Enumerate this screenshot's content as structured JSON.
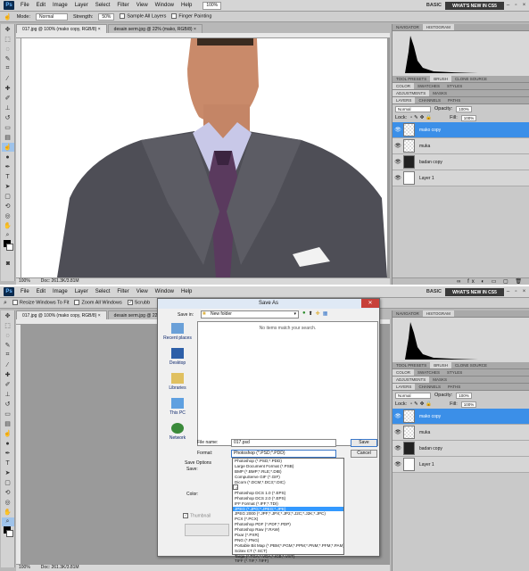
{
  "menubar": {
    "app_logo": "Ps",
    "items": [
      "File",
      "Edit",
      "Image",
      "Layer",
      "Select",
      "Filter",
      "View",
      "Window",
      "Help"
    ],
    "zoom": "100%",
    "workspace": "BASIC",
    "whats_new": "WHAT'S NEW IN CS5"
  },
  "top": {
    "options": {
      "mode_label": "Mode:",
      "mode_value": "Normal",
      "strength_label": "Strength:",
      "strength_value": "50%",
      "sample_all_layers": "Sample All Layers",
      "finger_painting": "Finger Painting"
    },
    "tabs": [
      "017.jpg @ 100% (mako copy, RGB/8) ×",
      "desain serm.jpg @ 22% (mako, RGB/8) ×"
    ],
    "status_zoom": "100%",
    "status_doc": "Doc: 261.3K/3.81M"
  },
  "bottom": {
    "options": {
      "resize_windows": "Resize Windows To Fit",
      "zoom_all_windows": "Zoom All Windows",
      "scrubby": "Scrubb"
    },
    "tabs": [
      "017.jpg @ 100% (mako copy, RGB/8) ×",
      "desain serm.jpg @ 22% (mako, RGB/8) ×"
    ],
    "status_zoom": "100%",
    "status_doc": "Doc: 261.3K/3.81M"
  },
  "panels": {
    "top_tabs": [
      "NAVIGATOR",
      "HISTOGRAM"
    ],
    "mid_tabs": [
      "TOOL PRESETS",
      "BRUSH",
      "CLONE SOURCE"
    ],
    "color_tabs": [
      "COLOR",
      "SWATCHES",
      "STYLES"
    ],
    "adjust_tabs": [
      "ADJUSTMENTS",
      "MASKS"
    ],
    "layer_tabs": [
      "LAYERS",
      "CHANNELS",
      "PATHS"
    ],
    "blend_mode": "Normal",
    "opacity_label": "Opacity:",
    "opacity_value": "100%",
    "lock_label": "Lock:",
    "fill_label": "Fill:",
    "fill_value": "100%",
    "layers": [
      "mako copy",
      "muka",
      "badan copy",
      "Layer 1"
    ]
  },
  "dialog": {
    "title": "Save As",
    "save_in_label": "Save in:",
    "save_in_value": "New folder",
    "empty_message": "No items match your search.",
    "places": [
      "Recent places",
      "Desktop",
      "Libraries",
      "This PC",
      "Network"
    ],
    "file_name_label": "File name:",
    "file_name_value": "017.psd",
    "format_label": "Format:",
    "format_value": "Photoshop (*.PSD;*.PDD)",
    "save_button": "Save",
    "cancel_button": "Cancel",
    "save_options_label": "Save Options",
    "save_label": "Save:",
    "color_label": "Color:",
    "thumbnail_label": "Thumbnail",
    "formats": [
      "Photoshop (*.PSD;*.PDD)",
      "Large Document Format (*.PSB)",
      "BMP (*.BMP;*.RLE;*.DIB)",
      "CompuServe GIF (*.GIF)",
      "Dicom (*.DCM;*.DC3;*.DIC)",
      "Photoshop EPS (*.EPS)",
      "Photoshop DCS 1.0 (*.EPS)",
      "Photoshop DCS 2.0 (*.EPS)",
      "IFF Format (*.IFF;*.TDI)",
      "JPEG (*.JPG;*.JPEG;*.JPE)",
      "JPEG 2000 (*.JPF;*.JPX;*.JP2;*.J2C;*.J2K;*.JPC)",
      "PCX (*.PCX)",
      "Photoshop PDF (*.PDF;*.PDP)",
      "Photoshop Raw (*.RAW)",
      "Pixar (*.PXR)",
      "PNG (*.PNG)",
      "Portable Bit Map (*.PBM;*.PGM;*.PPM;*.PNM;*.PFM;*.PAM)",
      "Scitex CT (*.SCT)",
      "Targa (*.TGA;*.VDA;*.ICB;*.VST)",
      "TIFF (*.TIF;*.TIFF)"
    ],
    "selected_format_index": 9,
    "checked_format_index": 5
  }
}
